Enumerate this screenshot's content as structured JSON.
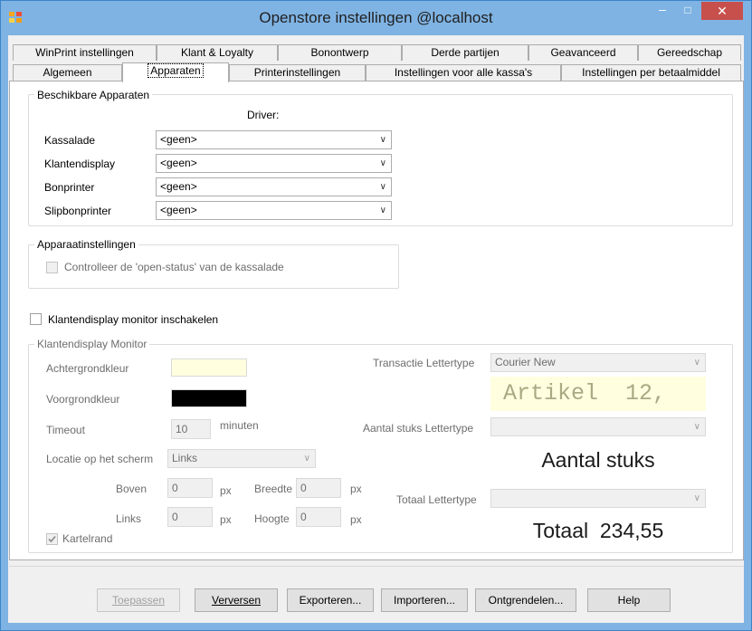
{
  "window": {
    "title": "Openstore instellingen @localhost",
    "minimize_glyph": "–",
    "maximize_glyph": "□",
    "close_glyph": "✕"
  },
  "tabs_row1": [
    "WinPrint instellingen",
    "Klant & Loyalty",
    "Bonontwerp",
    "Derde partijen",
    "Geavanceerd",
    "Gereedschap"
  ],
  "tabs_row2": [
    "Algemeen",
    "Apparaten",
    "Printerinstellingen",
    "Instellingen voor alle kassa's",
    "Instellingen per betaalmiddel"
  ],
  "devices": {
    "group_title": "Beschikbare Apparaten",
    "driver_header": "Driver:",
    "rows": [
      {
        "label": "Kassalade",
        "value": "<geen>"
      },
      {
        "label": "Klantendisplay",
        "value": "<geen>"
      },
      {
        "label": "Bonprinter",
        "value": "<geen>"
      },
      {
        "label": "Slipbonprinter",
        "value": "<geen>"
      }
    ]
  },
  "device_settings": {
    "group_title": "Apparaatinstellingen",
    "check_open_status": "Controlleer de 'open-status' van de kassalade"
  },
  "monitor_enable_label": "Klantendisplay monitor inschakelen",
  "monitor": {
    "group_title": "Klantendisplay Monitor",
    "background_label": "Achtergrondkleur",
    "background_color": "#ffffe0",
    "foreground_label": "Voorgrondkleur",
    "foreground_color": "#000000",
    "timeout_label": "Timeout",
    "timeout_value": "10",
    "timeout_unit": "minuten",
    "location_label": "Locatie op het scherm",
    "location_value": "Links",
    "top_label": "Boven",
    "top_value": "0",
    "left_label": "Links",
    "left_value": "0",
    "width_label": "Breedte",
    "width_value": "0",
    "height_label": "Hoogte",
    "height_value": "0",
    "px": "px",
    "border_label": "Kartelrand",
    "transaction_font_label": "Transactie Lettertype",
    "transaction_font_value": "Courier New",
    "transaction_preview": "Artikel  12,",
    "count_font_label": "Aantal stuks Lettertype",
    "count_font_value": "",
    "count_preview": "Aantal stuks",
    "total_font_label": "Totaal Lettertype",
    "total_font_value": "",
    "total_preview": "Totaal  234,55"
  },
  "buttons": {
    "apply": "Toepassen",
    "refresh": "Verversen",
    "export": "Exporteren...",
    "import": "Importeren...",
    "unlock": "Ontgrendelen...",
    "help": "Help"
  }
}
